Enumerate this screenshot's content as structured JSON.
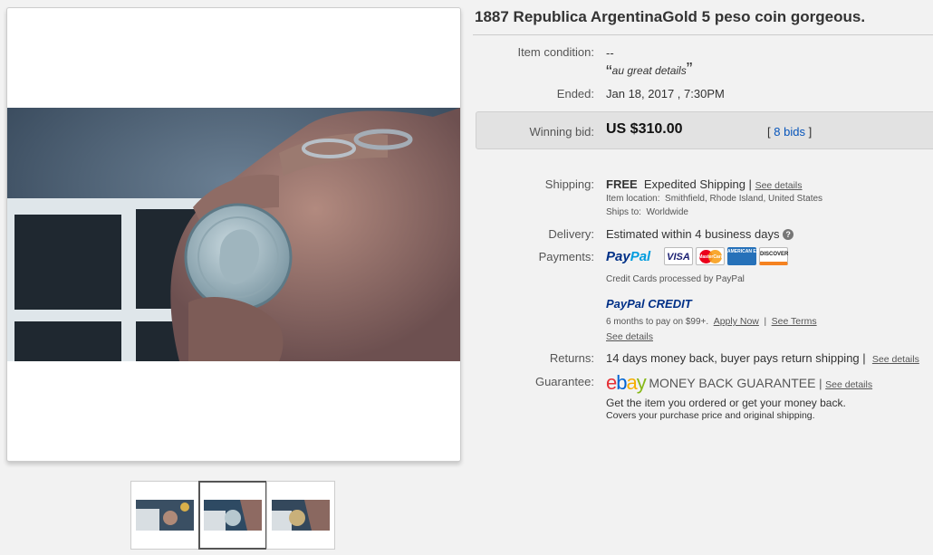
{
  "title": "1887 Republica ArgentinaGold 5 peso coin gorgeous.",
  "condition": {
    "label": "Item condition:",
    "value": "--",
    "quote_open": "“",
    "quote_text": "au great details",
    "quote_close": "”"
  },
  "ended": {
    "label": "Ended:",
    "value": "Jan 18, 2017 , 7:30PM"
  },
  "bid": {
    "label": "Winning bid:",
    "value": "US $310.00",
    "bids_open": "[",
    "bids_link": "8 bids",
    "bids_close": "]"
  },
  "shipping": {
    "label": "Shipping:",
    "free": "FREE",
    "method": "Expedited Shipping |",
    "details": "See details",
    "location_label": "Item location:",
    "location": "Smithfield, Rhode Island, United States",
    "ships_label": "Ships to:",
    "ships": "Worldwide"
  },
  "delivery": {
    "label": "Delivery:",
    "value": "Estimated within 4 business days",
    "help": "?"
  },
  "payments": {
    "label": "Payments:",
    "paypal_pay": "Pay",
    "paypal_pal": "Pal",
    "cards": [
      "VISA",
      "MasterCard",
      "AMERICAN EXPRESS",
      "DISCOVER"
    ],
    "note": "Credit Cards processed by PayPal",
    "credit_logo": "PayPal CREDIT",
    "credit_text": "6 months to pay on $99+.",
    "apply": "Apply Now",
    "terms": "See Terms",
    "see_details": "See details"
  },
  "returns": {
    "label": "Returns:",
    "value": "14 days money back, buyer pays return shipping |",
    "details": "See details"
  },
  "guarantee": {
    "label": "Guarantee:",
    "ebay_e": "e",
    "ebay_b": "b",
    "ebay_a": "a",
    "ebay_y": "y",
    "mbg": "MONEY BACK GUARANTEE",
    "sep": "|",
    "details": "See details",
    "line1": "Get the item you ordered or get your money back.",
    "line2": "Covers your purchase price and original shipping."
  },
  "colors": {
    "paypal_dark": "#003087",
    "paypal_light": "#009cde",
    "link": "#0654ba"
  }
}
